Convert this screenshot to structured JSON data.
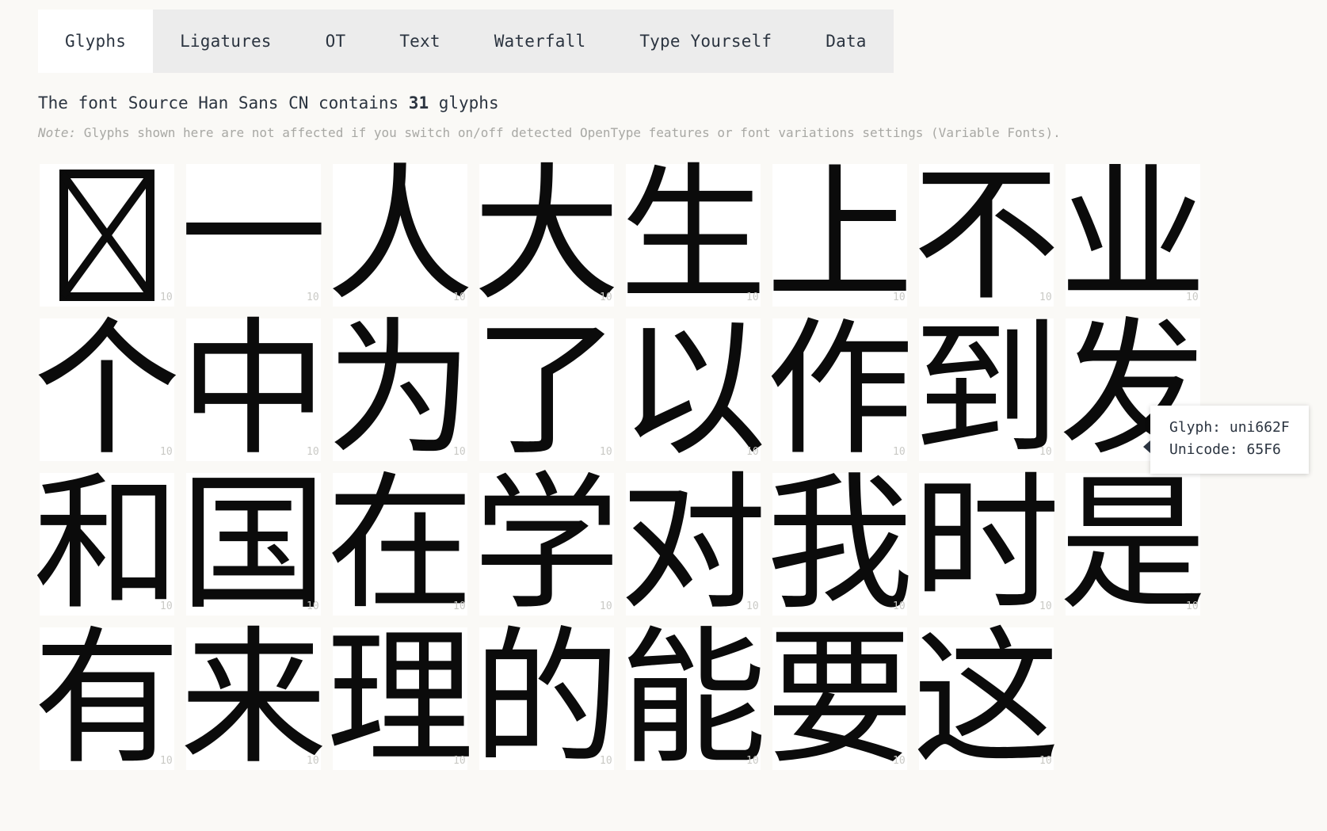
{
  "tabs": [
    {
      "label": "Glyphs",
      "active": true
    },
    {
      "label": "Ligatures",
      "active": false
    },
    {
      "label": "OT",
      "active": false
    },
    {
      "label": "Text",
      "active": false
    },
    {
      "label": "Waterfall",
      "active": false
    },
    {
      "label": "Type Yourself",
      "active": false
    },
    {
      "label": "Data",
      "active": false
    }
  ],
  "heading": {
    "prefix": "The font Source Han Sans CN contains ",
    "count": "31",
    "suffix": " glyphs",
    "font_name": "Source Han Sans CN",
    "glyph_count": "31"
  },
  "note": {
    "label": "Note:",
    "text": " Glyphs shown here are not affected if you switch on/off detected OpenType features or font variations settings (Variable Fonts)."
  },
  "grid": {
    "columns": 8,
    "rows": 4,
    "cell_id_label": "10",
    "cells": [
      {
        "glyph": "",
        "notdef": true,
        "id": "10"
      },
      {
        "glyph": "一",
        "id": "10"
      },
      {
        "glyph": "人",
        "id": "10"
      },
      {
        "glyph": "大",
        "id": "10"
      },
      {
        "glyph": "生",
        "id": "10"
      },
      {
        "glyph": "上",
        "id": "10"
      },
      {
        "glyph": "不",
        "id": "10"
      },
      {
        "glyph": "业",
        "id": "10"
      },
      {
        "glyph": "个",
        "id": "10"
      },
      {
        "glyph": "中",
        "id": "10"
      },
      {
        "glyph": "为",
        "id": "10"
      },
      {
        "glyph": "了",
        "id": "10"
      },
      {
        "glyph": "以",
        "id": "10"
      },
      {
        "glyph": "作",
        "id": "10"
      },
      {
        "glyph": "到",
        "id": "10"
      },
      {
        "glyph": "发",
        "id": "10"
      },
      {
        "glyph": "和",
        "id": "10"
      },
      {
        "glyph": "国",
        "id": "10"
      },
      {
        "glyph": "在",
        "id": "10"
      },
      {
        "glyph": "学",
        "id": "10"
      },
      {
        "glyph": "对",
        "id": "10"
      },
      {
        "glyph": "我",
        "id": "10"
      },
      {
        "glyph": "时",
        "id": "10"
      },
      {
        "glyph": "是",
        "id": "10"
      },
      {
        "glyph": "有",
        "id": "10"
      },
      {
        "glyph": "来",
        "id": "10"
      },
      {
        "glyph": "理",
        "id": "10"
      },
      {
        "glyph": "的",
        "id": "10"
      },
      {
        "glyph": "能",
        "id": "10"
      },
      {
        "glyph": "要",
        "id": "10"
      },
      {
        "glyph": "这",
        "id": "10"
      },
      {
        "glyph": "",
        "empty": true
      }
    ]
  },
  "tooltip": {
    "glyph_line": "Glyph: uni662F",
    "unicode_line": "Unicode: 65F6"
  },
  "colors": {
    "page_background": "#faf9f6",
    "tab_inactive_bg": "#ececec",
    "tab_active_bg": "#ffffff",
    "cell_bg": "#ffffff",
    "text": "#2b3440",
    "note_text": "#a8a8a4",
    "glyph_ink": "#0b0b0b",
    "cell_id": "#c9c9c5"
  }
}
